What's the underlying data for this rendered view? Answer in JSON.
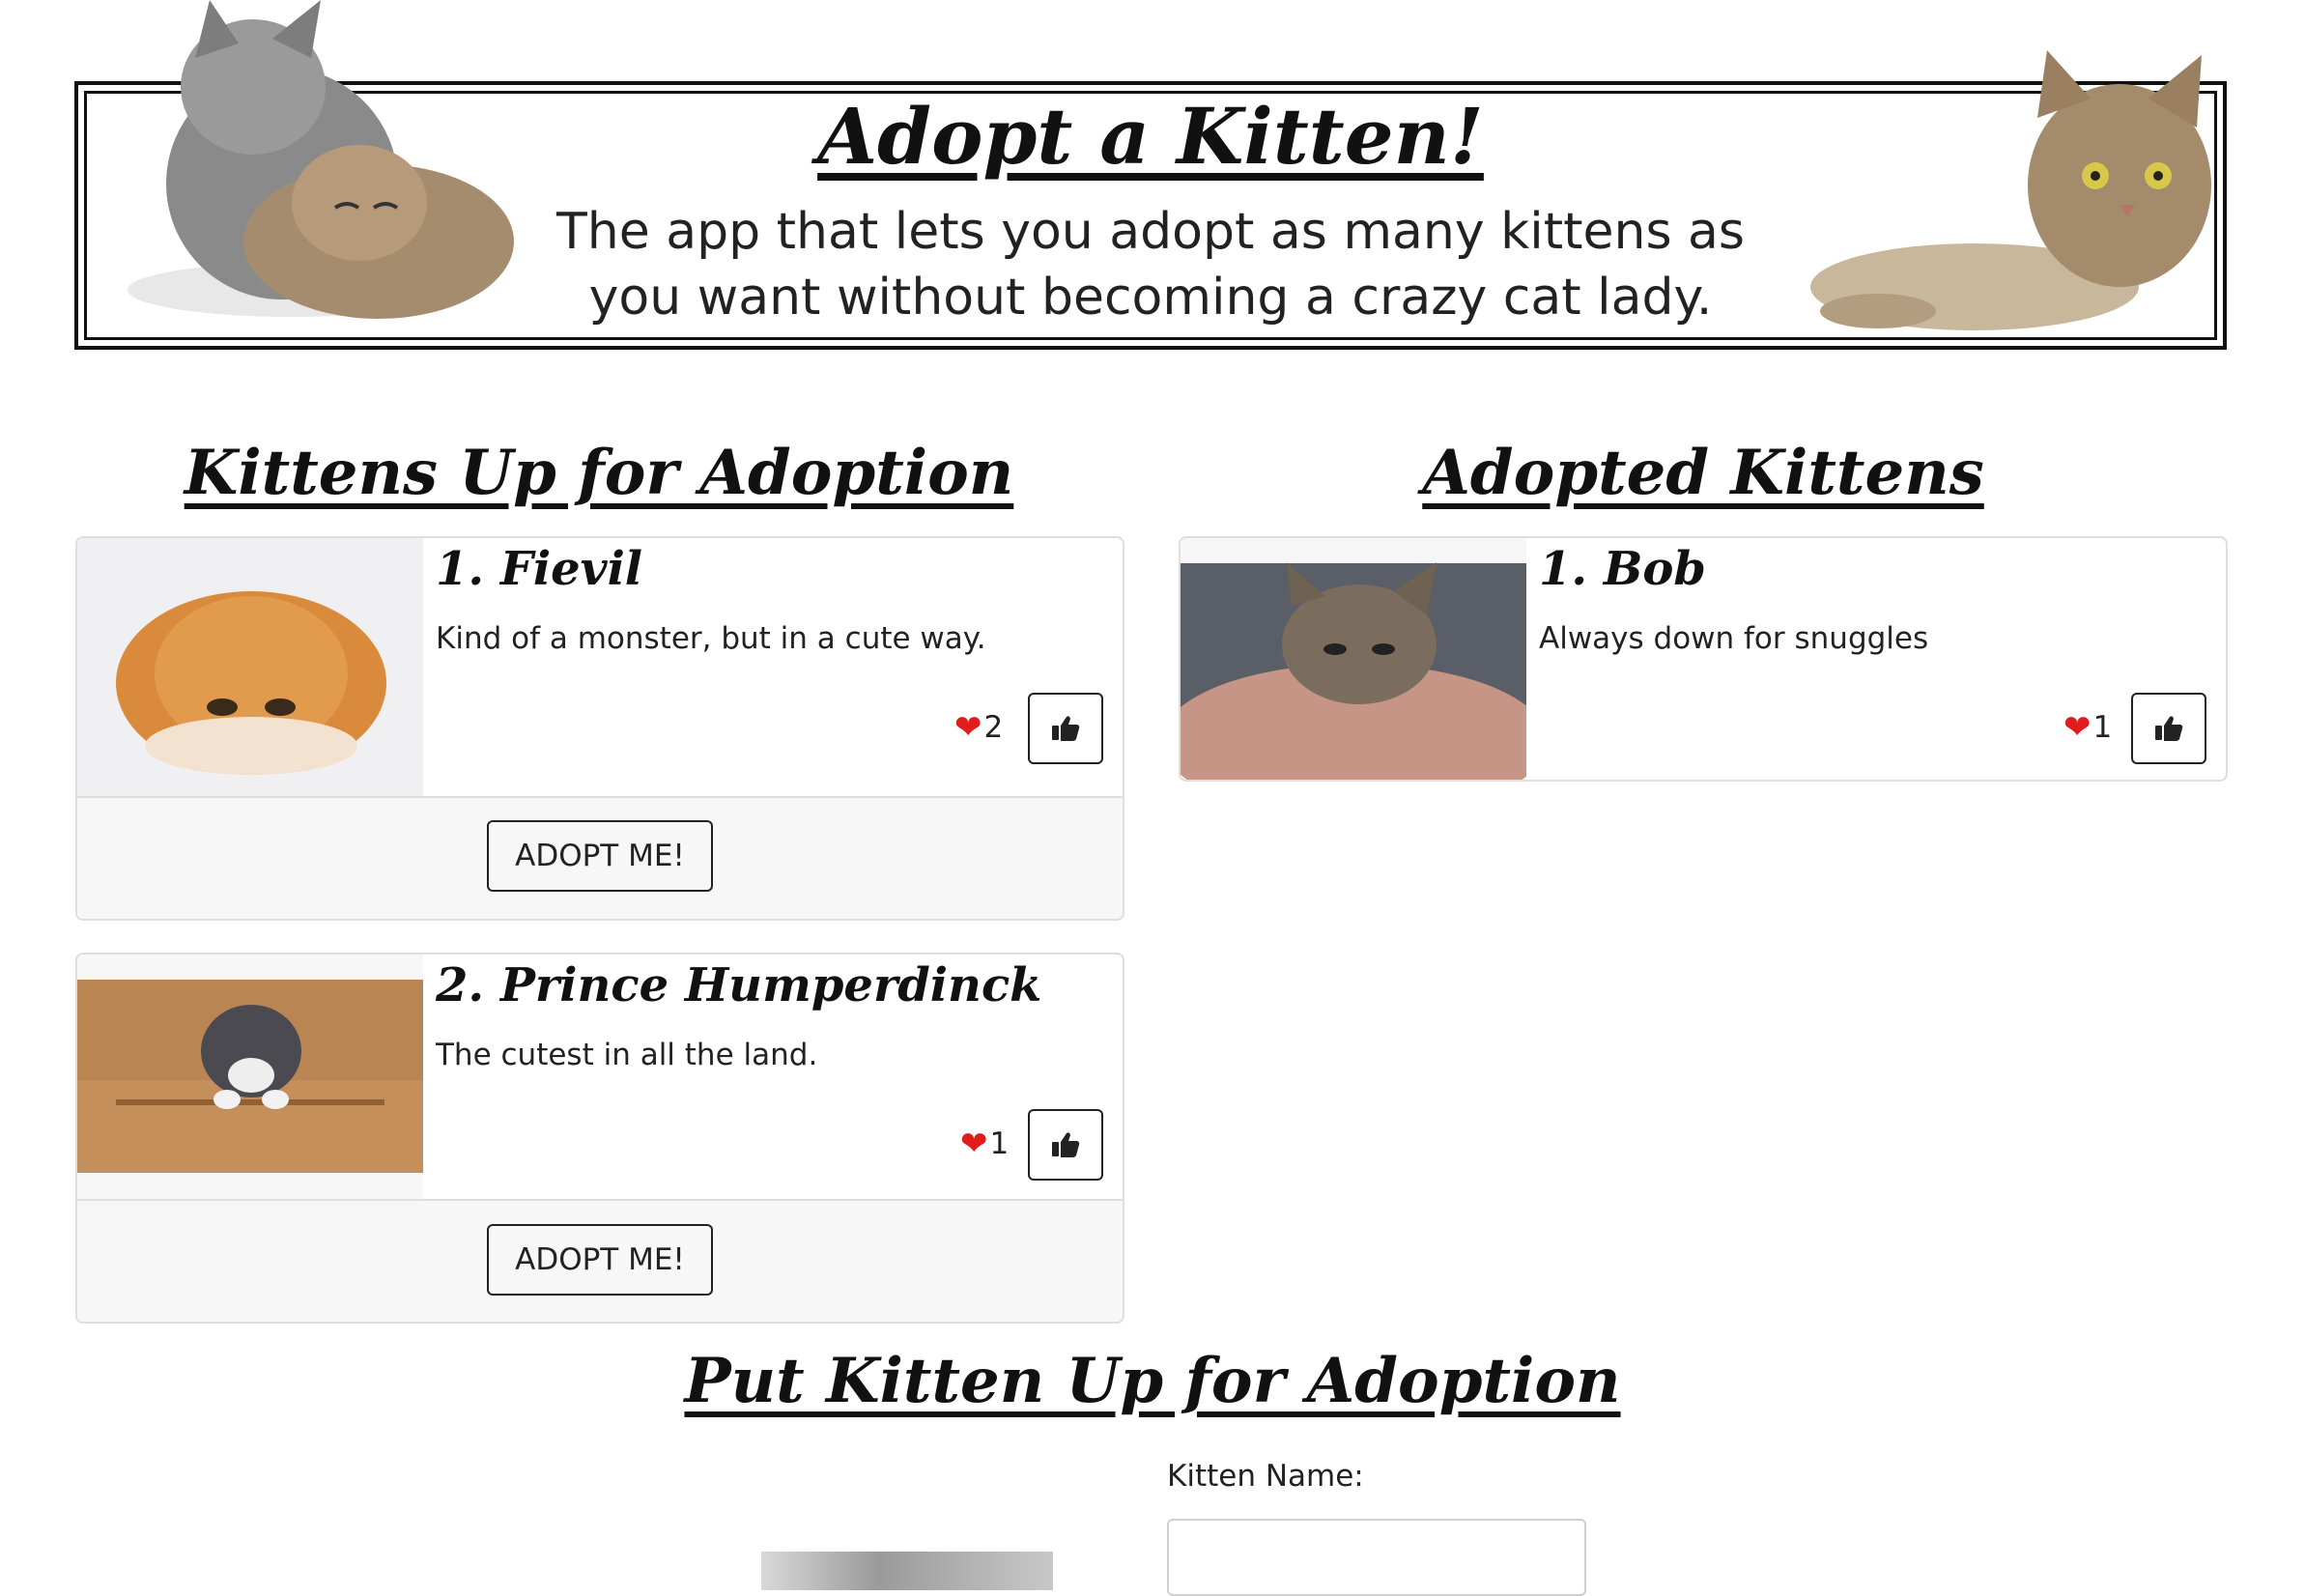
{
  "banner": {
    "title": "Adopt a Kitten!",
    "subtitle_line1": "The app that lets you adopt as many kittens as",
    "subtitle_line2": "you want without becoming a crazy cat lady."
  },
  "available": {
    "heading": "Kittens Up for Adoption",
    "kittens": [
      {
        "name": "1. Fievil",
        "description": "Kind of a monster, but in a cute way.",
        "likes": "2",
        "adopt_label": "ADOPT ME!"
      },
      {
        "name": "2. Prince Humperdinck",
        "description": "The cutest in all the land.",
        "likes": "1",
        "adopt_label": "ADOPT ME!"
      }
    ]
  },
  "adopted": {
    "heading": "Adopted Kittens",
    "kittens": [
      {
        "name": "1. Bob",
        "description": "Always down for snuggles",
        "likes": "1"
      }
    ]
  },
  "form": {
    "heading": "Put Kitten Up for Adoption",
    "name_label": "Kitten Name:"
  },
  "colors": {
    "heart": "#e21b1b",
    "card_border": "#dedede",
    "footer_bg": "#f7f7f7"
  },
  "icons": {
    "like": "heart-icon",
    "upvote": "thumbs-up-icon"
  }
}
